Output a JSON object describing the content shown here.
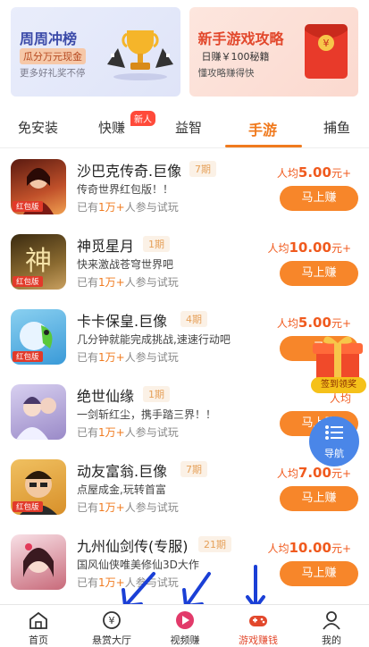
{
  "banners": {
    "left": {
      "title": "周周冲榜",
      "tag": "瓜分万元现金",
      "sub": "更多好礼奖不停"
    },
    "right": {
      "title": "新手游戏攻略",
      "tag": "日赚￥100秘籍",
      "sub": "懂攻略赚得快"
    }
  },
  "tabs": [
    {
      "label": "免安装"
    },
    {
      "label": "快赚"
    },
    {
      "label": "益智"
    },
    {
      "label": "手游"
    },
    {
      "label": "捕鱼"
    }
  ],
  "new_badge": "新人",
  "games": [
    {
      "name": "沙巴克传奇.巨像",
      "period": "7期",
      "desc": "传奇世界红包版！！",
      "players_prefix": "已有",
      "players_count": "1万+",
      "players_suffix": "人参与试玩",
      "reward_prefix": "人均",
      "reward_amount": "5.00",
      "reward_suffix": "元+",
      "button": "马上赚",
      "ribbon": "红包版"
    },
    {
      "name": "神觅星月",
      "period": "1期",
      "desc": "快来激战苍穹世界吧",
      "players_prefix": "已有",
      "players_count": "1万+",
      "players_suffix": "人参与试玩",
      "reward_prefix": "人均",
      "reward_amount": "10.00",
      "reward_suffix": "元+",
      "button": "马上赚",
      "ribbon": "红包版"
    },
    {
      "name": "卡卡保皇.巨像",
      "period": "4期",
      "desc": "几分钟就能完成挑战,速速行动吧",
      "players_prefix": "已有",
      "players_count": "1万+",
      "players_suffix": "人参与试玩",
      "reward_prefix": "人均",
      "reward_amount": "5.00",
      "reward_suffix": "元+",
      "button": "马",
      "ribbon": "红包版"
    },
    {
      "name": "绝世仙缘",
      "period": "1期",
      "desc": "一剑斩红尘，携手踏三界！！",
      "players_prefix": "已有",
      "players_count": "1万+",
      "players_suffix": "人参与试玩",
      "reward_prefix": "人均",
      "reward_amount": "",
      "reward_suffix": "",
      "button": "马上赚",
      "ribbon": ""
    },
    {
      "name": "动友富翁.巨像",
      "period": "7期",
      "desc": "点屋成金,玩转首富",
      "players_prefix": "已有",
      "players_count": "1万+",
      "players_suffix": "人参与试玩",
      "reward_prefix": "人均",
      "reward_amount": "7.00",
      "reward_suffix": "元+",
      "button": "马上赚",
      "ribbon": "红包版"
    },
    {
      "name": "九州仙剑传(专服)",
      "period": "21期",
      "desc": "国风仙侠唯美修仙3D大作",
      "players_prefix": "已有",
      "players_count": "1万+",
      "players_suffix": "人参与试玩",
      "reward_prefix": "人均",
      "reward_amount": "10.00",
      "reward_suffix": "元+",
      "button": "马上赚",
      "ribbon": ""
    }
  ],
  "floating": {
    "gift_label": "签到领奖",
    "nav_label": "导航"
  },
  "bottom_nav": [
    {
      "label": "首页",
      "icon": "home-icon"
    },
    {
      "label": "悬赏大厅",
      "icon": "yuan-coin-icon"
    },
    {
      "label": "视频赚",
      "icon": "video-play-icon"
    },
    {
      "label": "游戏赚钱",
      "icon": "gamepad-icon"
    },
    {
      "label": "我的",
      "icon": "user-icon"
    }
  ],
  "colors": {
    "accent": "#f07a1e",
    "button": "#f7862a",
    "active_nav": "#e2482c",
    "float_nav": "#4a86e8",
    "arrow": "#1a3fd6"
  }
}
